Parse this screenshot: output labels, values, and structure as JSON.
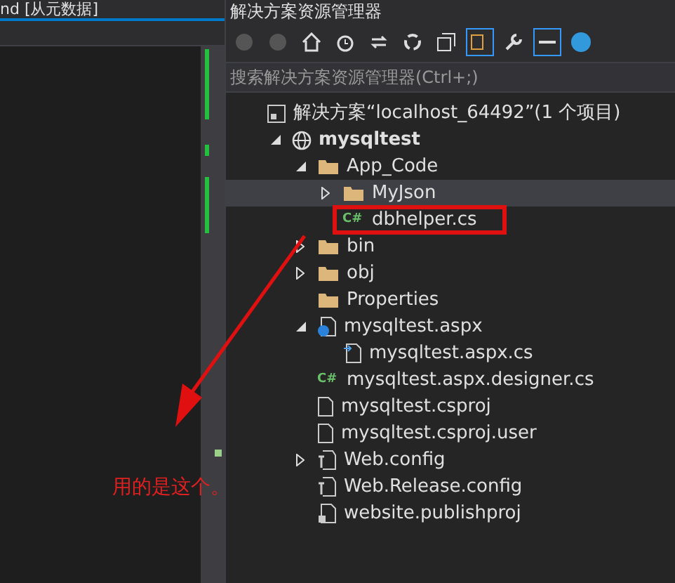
{
  "editor": {
    "tab_title": "nd [从元数据]"
  },
  "explorer": {
    "title": "解决方案资源管理器",
    "search": {
      "placeholder": "搜索解决方案资源管理器(Ctrl+;)"
    },
    "tree": [
      {
        "label": "解决方案“localhost_64492”(1 个项目)",
        "kind": "solution",
        "selected": false,
        "children": [
          {
            "label": "mysqltest",
            "kind": "web",
            "bold": true,
            "selected": false,
            "expanded": true,
            "children": [
              {
                "label": "App_Code",
                "kind": "folder",
                "bold": false,
                "selected": false,
                "expanded": true,
                "children": [
                  {
                    "label": "MyJson",
                    "kind": "folder",
                    "bold": false,
                    "selected": true,
                    "expanded": false
                  },
                  {
                    "label": "dbhelper.cs",
                    "kind": "csharp",
                    "badge": "C#",
                    "bold": false,
                    "selected": false,
                    "highlighted": true
                  }
                ]
              },
              {
                "label": "bin",
                "kind": "folder",
                "bold": false,
                "selected": false,
                "expanded": false
              },
              {
                "label": "obj",
                "kind": "folder",
                "bold": false,
                "selected": false,
                "expanded": false
              },
              {
                "label": "Properties",
                "kind": "folder",
                "bold": false,
                "selected": false
              },
              {
                "label": "mysqltest.aspx",
                "kind": "aspx",
                "bold": false,
                "selected": false,
                "expanded": true,
                "children": [
                  {
                    "label": "mysqltest.aspx.cs",
                    "kind": "codebehind",
                    "bold": false,
                    "selected": false
                  }
                ]
              },
              {
                "label": "mysqltest.aspx.designer.cs",
                "kind": "csharp",
                "badge": "C#",
                "bold": false,
                "selected": false
              },
              {
                "label": "mysqltest.csproj",
                "kind": "file",
                "bold": false,
                "selected": false
              },
              {
                "label": "mysqltest.csproj.user",
                "kind": "file",
                "bold": false,
                "selected": false
              },
              {
                "label": "Web.config",
                "kind": "config",
                "bold": false,
                "selected": false,
                "expanded": false
              },
              {
                "label": "Web.Release.config",
                "kind": "config",
                "bold": false,
                "selected": false
              },
              {
                "label": "website.publishproj",
                "kind": "publish",
                "bold": false,
                "selected": false
              }
            ]
          }
        ]
      }
    ]
  },
  "annotation": {
    "text": "用的是这个。"
  }
}
